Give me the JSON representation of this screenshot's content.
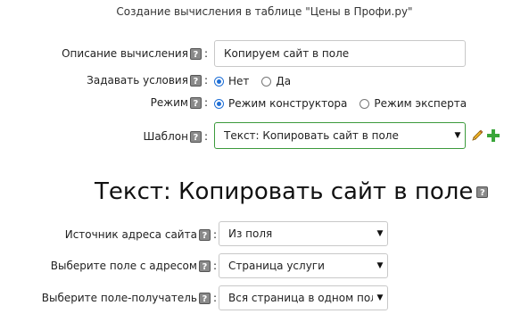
{
  "header": {
    "title": "Создание вычисления в таблице \"Цены в Профи.ру\""
  },
  "help_glyph": "?",
  "colon": ":",
  "form": {
    "description": {
      "label": "Описание вычисления",
      "value": "Копируем сайт в поле"
    },
    "conditions": {
      "label": "Задавать условия",
      "options": [
        "Нет",
        "Да"
      ],
      "selected": "Нет"
    },
    "mode": {
      "label": "Режим",
      "options": [
        "Режим конструктора",
        "Режим эксперта"
      ],
      "selected": "Режим конструктора"
    },
    "template": {
      "label": "Шаблон",
      "value": "Текст: Копировать сайт в поле"
    }
  },
  "section": {
    "title": "Текст: Копировать сайт в поле",
    "fields": [
      {
        "label": "Источник адреса сайта",
        "value": "Из поля"
      },
      {
        "label": "Выберите поле с адресом",
        "value": "Страница услуги"
      },
      {
        "label": "Выберите поле-получатель",
        "value": "Вся страница в одном поле"
      }
    ]
  },
  "icons": {
    "edit": "pencil-icon",
    "add": "plus-icon",
    "dropdown": "triangle-down-icon"
  },
  "colors": {
    "accent_radio": "#1f6fd6",
    "template_border": "#3c9a3c",
    "add_icon": "#3aa63a"
  }
}
